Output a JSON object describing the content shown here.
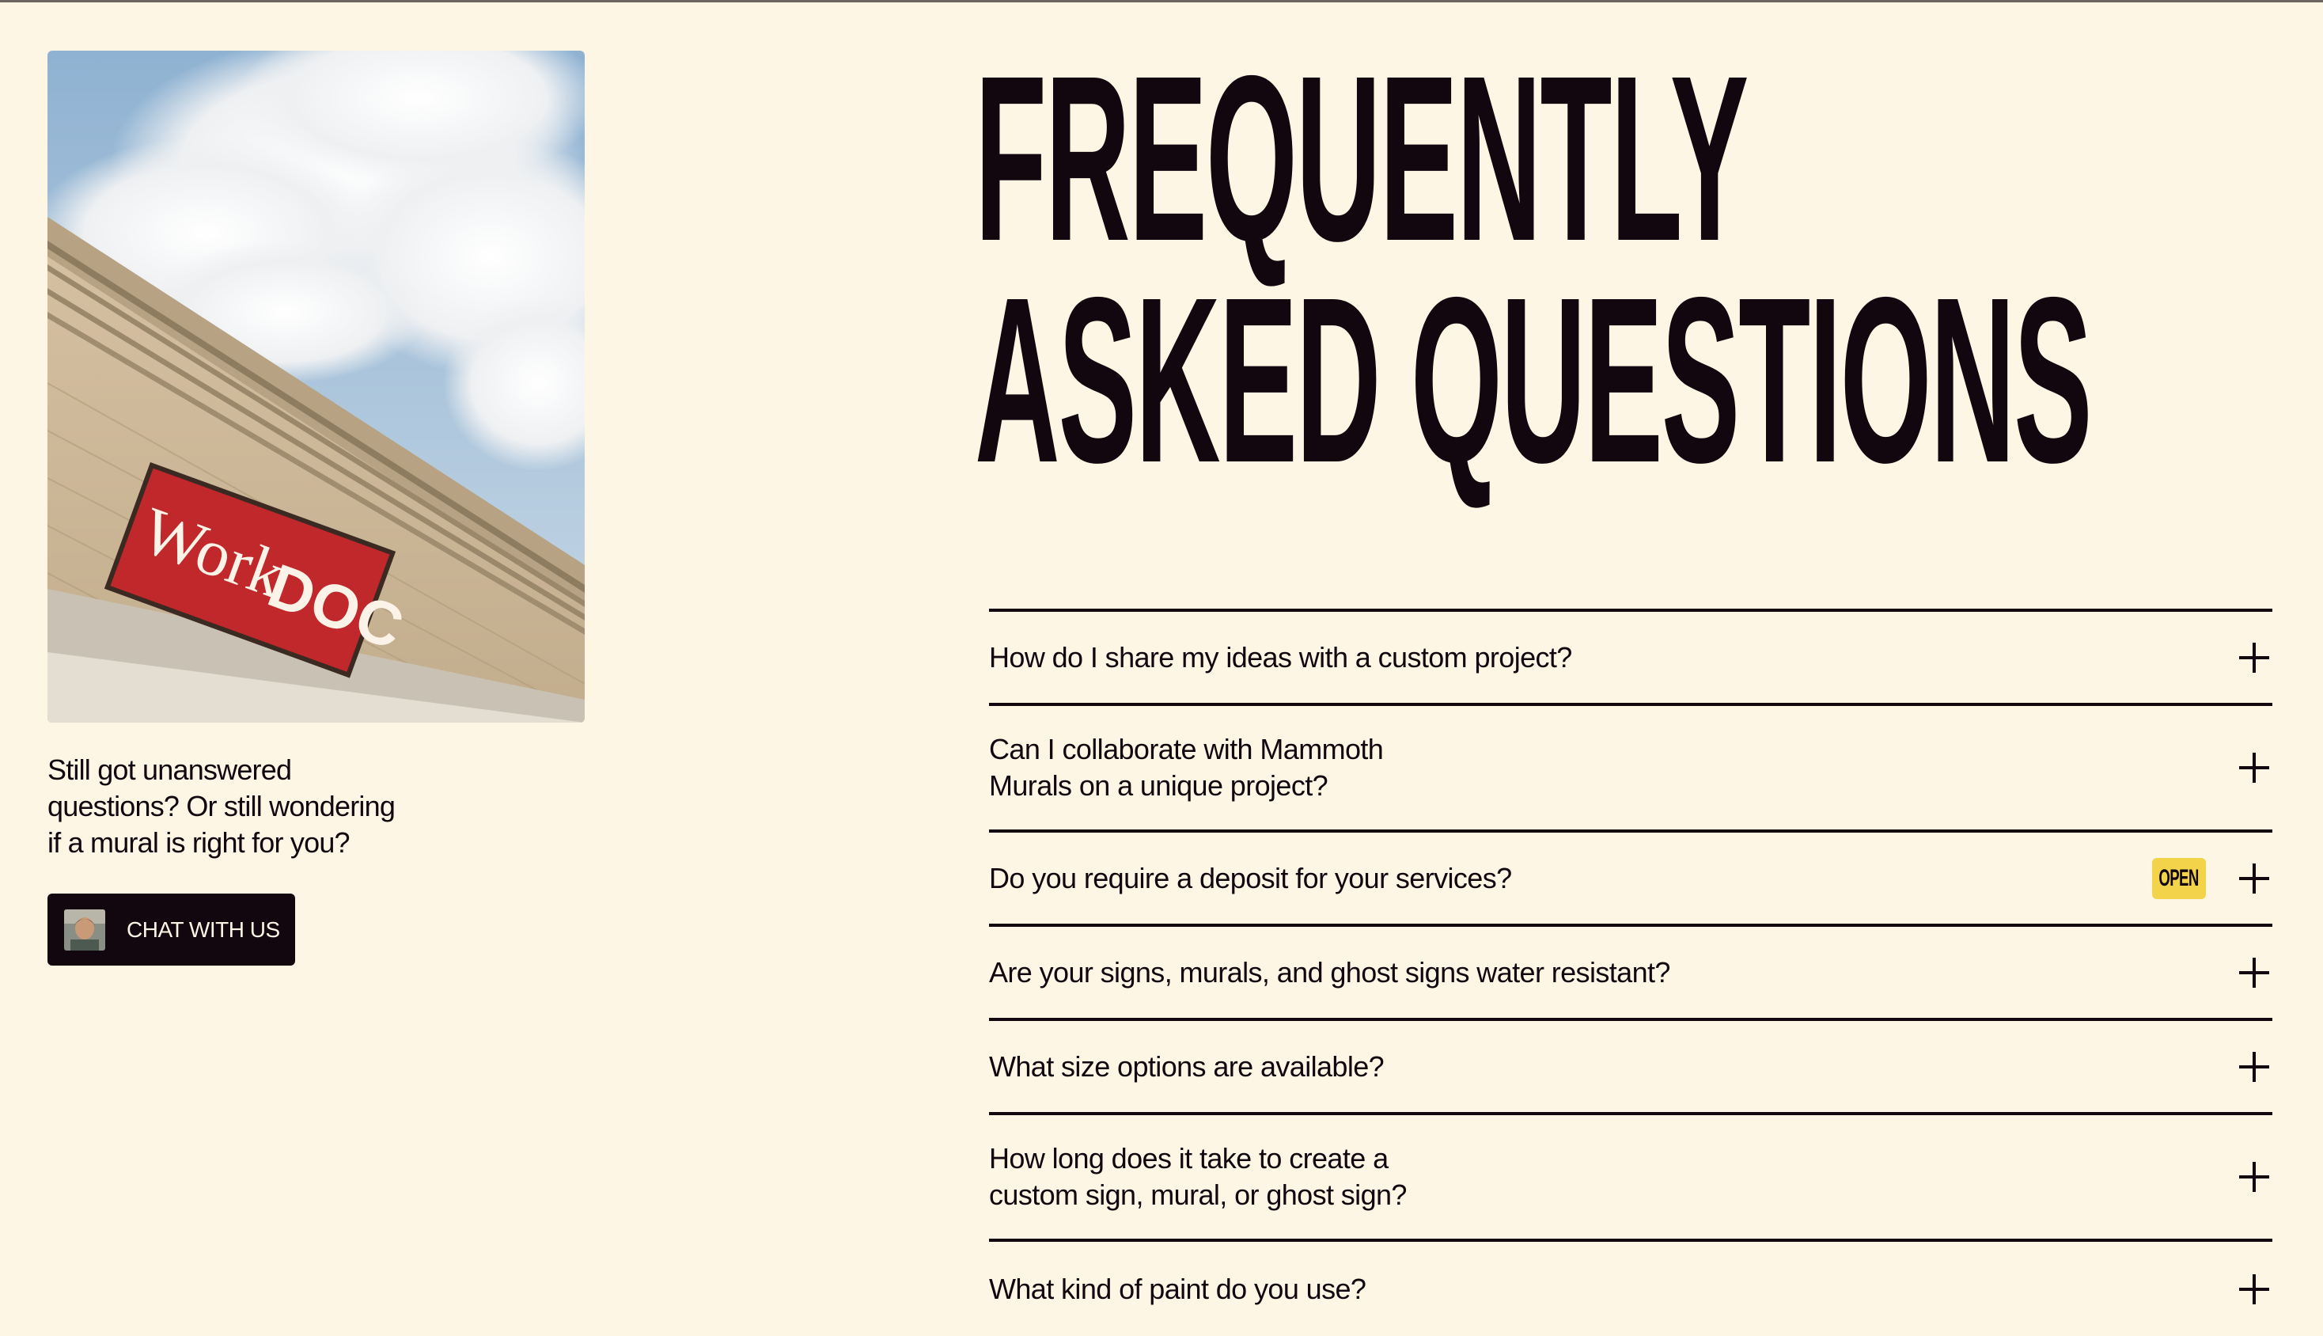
{
  "photo": {
    "sign_text_work": "Work",
    "sign_text_doc": "DOC"
  },
  "sidebar": {
    "prompt_lines": [
      "Still got unanswered",
      "questions? Or still wondering",
      "if a mural is right for you?"
    ],
    "chat_button_label": "CHAT WITH US"
  },
  "headline": {
    "line1": "FREQUENTLY",
    "line2": "ASKED QUESTIONS"
  },
  "faq": {
    "items": [
      {
        "question": "How do I share my ideas with a custom project?"
      },
      {
        "question": "Can I collaborate with Mammoth Murals on a unique project?"
      },
      {
        "question": "Do you require a deposit for your services?",
        "badge": "OPEN"
      },
      {
        "question": "Are your signs, murals, and ghost signs water resistant?"
      },
      {
        "question": "What size options are available?"
      },
      {
        "question": "How long does it take to create a custom sign, mural, or ghost sign?"
      },
      {
        "question": "What kind of paint do you use?"
      }
    ]
  },
  "colors": {
    "background": "#fdf6e5",
    "ink": "#12060f",
    "badge": "#f3d34a",
    "sign_red": "#c0282b"
  },
  "icons": [
    "plus-icon",
    "avatar"
  ]
}
